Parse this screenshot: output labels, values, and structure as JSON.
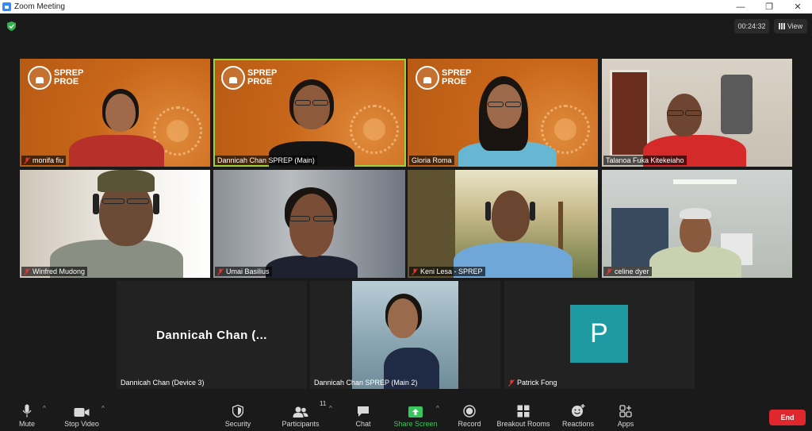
{
  "window": {
    "title": "Zoom Meeting",
    "controls": [
      "—",
      "❐",
      "✕"
    ]
  },
  "header": {
    "timer": "00:24:32",
    "view_label": "View"
  },
  "tiles": [
    {
      "name": "monifa fiu",
      "bg": "sprep"
    },
    {
      "name": "Dannicah Chan SPREP (Main)",
      "bg": "sprep",
      "active": true
    },
    {
      "name": "Gloria Roma",
      "bg": "sprep"
    },
    {
      "name": "Talanoa Fuka Kitekeiaho",
      "bg": "office"
    },
    {
      "name": "Winfred Mudong",
      "bg": "room"
    },
    {
      "name": "Umai Basilius",
      "bg": "blur"
    },
    {
      "name": "Keni Lesa - SPREP",
      "bg": "veranda"
    },
    {
      "name": "celine dyer",
      "bg": "office2"
    },
    {
      "name": "Dannicah Chan (Device 3)",
      "big_label": "Dannicah Chan (..."
    },
    {
      "name": "Dannicah Chan SPREP (Main 2)",
      "bg": "sea"
    },
    {
      "name": "Patrick Fong",
      "avatar_letter": "P"
    }
  ],
  "logo_text": [
    "SPREP",
    "PROE"
  ],
  "toolbar": {
    "mute": "Mute",
    "stop_video": "Stop Video",
    "security": "Security",
    "participants": "Participants",
    "participants_count": "11",
    "chat": "Chat",
    "share_screen": "Share Screen",
    "record": "Record",
    "breakout_rooms": "Breakout Rooms",
    "reactions": "Reactions",
    "apps": "Apps",
    "end": "End"
  },
  "colors": {
    "accent_green": "#38c75a",
    "end_red": "#e0272d",
    "active_border": "#9fd13c",
    "avatar_teal": "#1f9aa3",
    "sprep_orange": "#c8671a"
  }
}
